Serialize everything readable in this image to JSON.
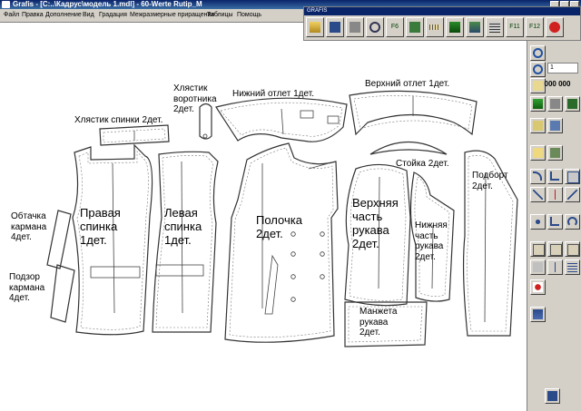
{
  "window": {
    "title": "Grafis - [C:..\\Кадрус\\модель 1.mdl] - 60-Werte Rutip_M"
  },
  "menu": [
    "Файл",
    "Правка",
    "Дополнение",
    "Вид",
    "Градация",
    "Межразмерные приращения",
    "Таблицы",
    "Помощь"
  ],
  "grafis_toolbar": {
    "title": "GRAFIS",
    "buttons": [
      {
        "name": "open-icon",
        "label": ""
      },
      {
        "name": "save-icon",
        "label": ""
      },
      {
        "name": "print-icon",
        "label": ""
      },
      {
        "name": "zoom-icon",
        "label": ""
      },
      {
        "name": "f6-icon",
        "label": "F6"
      },
      {
        "name": "layout-icon",
        "label": ""
      },
      {
        "name": "ruler-icon",
        "label": ""
      },
      {
        "name": "download-icon",
        "label": ""
      },
      {
        "name": "import-icon",
        "label": ""
      },
      {
        "name": "grid-icon",
        "label": ""
      },
      {
        "name": "f11-icon",
        "label": "F11"
      },
      {
        "name": "f12-icon",
        "label": "F12"
      },
      {
        "name": "stop-icon",
        "label": ""
      }
    ]
  },
  "right_panel": {
    "input_value": "1",
    "counter": "000 000"
  },
  "pieces": {
    "back_stay": "Хлястик спинки 2дет.",
    "collar_stay": "Хлястик\nворотника\n2дет.",
    "lower_facing": "Нижний отлет 1дет.",
    "upper_facing": "Верхний отлет 1дет.",
    "stand": "Стойка 2дет.",
    "lining": "Подборт\n2дет.",
    "right_back": "Правая\nспинка\n1дет.",
    "left_back": "Левая\nспинка\n1дет.",
    "front": "Полочка\n2дет.",
    "upper_sleeve": "Верхняя\nчасть\nрукава\n2дет.",
    "lower_sleeve": "Нижняя\nчасть\nрукава\n2дет.",
    "pocket_facing": "Обтачка\nкармана\n4дет.",
    "pocket_lining": "Подзор\nкармана\n4дет.",
    "cuff": "Манжета\nрукава\n2дет."
  },
  "colors": {
    "titlebar": "#0a246a",
    "chrome": "#d4d0c8",
    "canvas": "#ffffff",
    "outline": "#333333"
  }
}
